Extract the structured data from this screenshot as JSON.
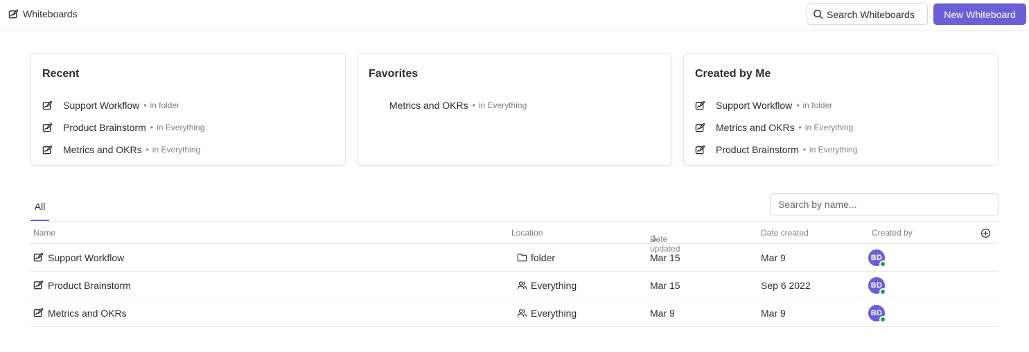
{
  "header": {
    "title": "Whiteboards",
    "search_button": "Search Whiteboards",
    "new_button": "New Whiteboard"
  },
  "recent": {
    "title": "Recent",
    "items": [
      {
        "name": "Support Workflow",
        "location": "in folder",
        "icon": "whiteboard-icon"
      },
      {
        "name": "Product Brainstorm",
        "location": "in Everything",
        "icon": "whiteboard-icon"
      },
      {
        "name": "Metrics and OKRs",
        "location": "in Everything",
        "icon": "whiteboard-icon"
      }
    ]
  },
  "favorites": {
    "title": "Favorites",
    "items": [
      {
        "name": "Metrics and OKRs",
        "location": "in Everything"
      }
    ]
  },
  "created_by_me": {
    "title": "Created by Me",
    "items": [
      {
        "name": "Support Workflow",
        "location": "in folder",
        "icon": "whiteboard-icon"
      },
      {
        "name": "Metrics and OKRs",
        "location": "in Everything",
        "icon": "whiteboard-icon"
      },
      {
        "name": "Product Brainstorm",
        "location": "in Everything",
        "icon": "whiteboard-icon"
      }
    ]
  },
  "list": {
    "tab_all": "All",
    "search_placeholder": "Search by name...",
    "columns": {
      "name": "Name",
      "location": "Location",
      "date_updated": "Date updated",
      "date_created": "Date created",
      "created_by": "Created by"
    },
    "sort_indicator": "arrow-down-icon",
    "rows": [
      {
        "name": "Support Workflow",
        "location": "folder",
        "location_icon": "folder-icon",
        "date_updated": "Mar 15",
        "date_created": "Mar 9",
        "created_by": "BD"
      },
      {
        "name": "Product Brainstorm",
        "location": "Everything",
        "location_icon": "people-icon",
        "date_updated": "Mar 15",
        "date_created": "Sep 6 2022",
        "created_by": "BD"
      },
      {
        "name": "Metrics and OKRs",
        "location": "Everything",
        "location_icon": "people-icon",
        "date_updated": "Mar 9",
        "date_created": "Mar 9",
        "created_by": "BD"
      }
    ]
  },
  "colors": {
    "accent": "#6b5fd8",
    "online": "#1aa15c",
    "muted_text": "#7c828d"
  }
}
